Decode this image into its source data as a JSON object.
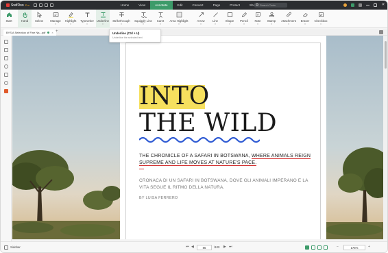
{
  "app": {
    "name": "SwifDoo",
    "edition": "Pro"
  },
  "menu": [
    "Home",
    "View",
    "Annotate",
    "Edit",
    "Convert",
    "Page",
    "Protect",
    "Share",
    "Help"
  ],
  "menu_active": "Annotate",
  "search": {
    "placeholder": "Search Tools"
  },
  "tools": [
    {
      "label": "Start",
      "icon": "home-icon"
    },
    {
      "label": "Hand",
      "icon": "hand-icon"
    },
    {
      "label": "Select",
      "icon": "cursor-icon"
    },
    {
      "label": "Manage",
      "icon": "manage-icon"
    },
    {
      "label": "Highlight",
      "icon": "highlight-icon"
    },
    {
      "label": "Typewriter",
      "icon": "typewriter-icon"
    },
    {
      "label": "Underline",
      "icon": "underline-icon"
    },
    {
      "label": "Strikethrough",
      "icon": "strikethrough-icon"
    },
    {
      "label": "Squiggly Line",
      "icon": "squiggly-icon"
    },
    {
      "label": "Caret",
      "icon": "caret-icon"
    },
    {
      "label": "Area Highlight",
      "icon": "area-highlight-icon"
    },
    {
      "label": "Arrow",
      "icon": "arrow-icon"
    },
    {
      "label": "Line",
      "icon": "line-icon"
    },
    {
      "label": "Shape",
      "icon": "shape-icon"
    },
    {
      "label": "Pencil",
      "icon": "pencil-icon"
    },
    {
      "label": "Note",
      "icon": "note-icon"
    },
    {
      "label": "Stamp",
      "icon": "stamp-icon"
    },
    {
      "label": "Attachment",
      "icon": "attachment-icon"
    },
    {
      "label": "Eraser",
      "icon": "eraser-icon"
    },
    {
      "label": "Checkbox",
      "icon": "checkbox-icon"
    }
  ],
  "tooltip": {
    "title": "Underline (Ctrl + U)",
    "desc": "Underline the selected text"
  },
  "tab": {
    "label": "BYS A Selection of Fine Na...pdf"
  },
  "document": {
    "title_line1": "INTO",
    "title_line2": "THE WILD",
    "sub_en_a": "THE CHRONICLE OF A SAFARI IN BOTSWANA, ",
    "sub_en_b": "WHERE ANIMALS REIGN SUPREME AND LIFE MOVES AT NATURE'S PACE.",
    "sub_it": "CRONACA DI UN SAFARI IN BOTSWANA, DOVE GLI ANIMALI IMPERANO E LA VITA SEGUE IL RITMO DELLA NATURA.",
    "author": "BY LUISA FERRERO"
  },
  "status": {
    "sidebar": "Sidebar",
    "page": "85",
    "total": "/100",
    "zoom": "175%"
  },
  "colors": {
    "accent": "#3d9b6a",
    "highlight": "#f6e05e",
    "underline": "#d32f2f",
    "wave": "#2f5bd3"
  }
}
